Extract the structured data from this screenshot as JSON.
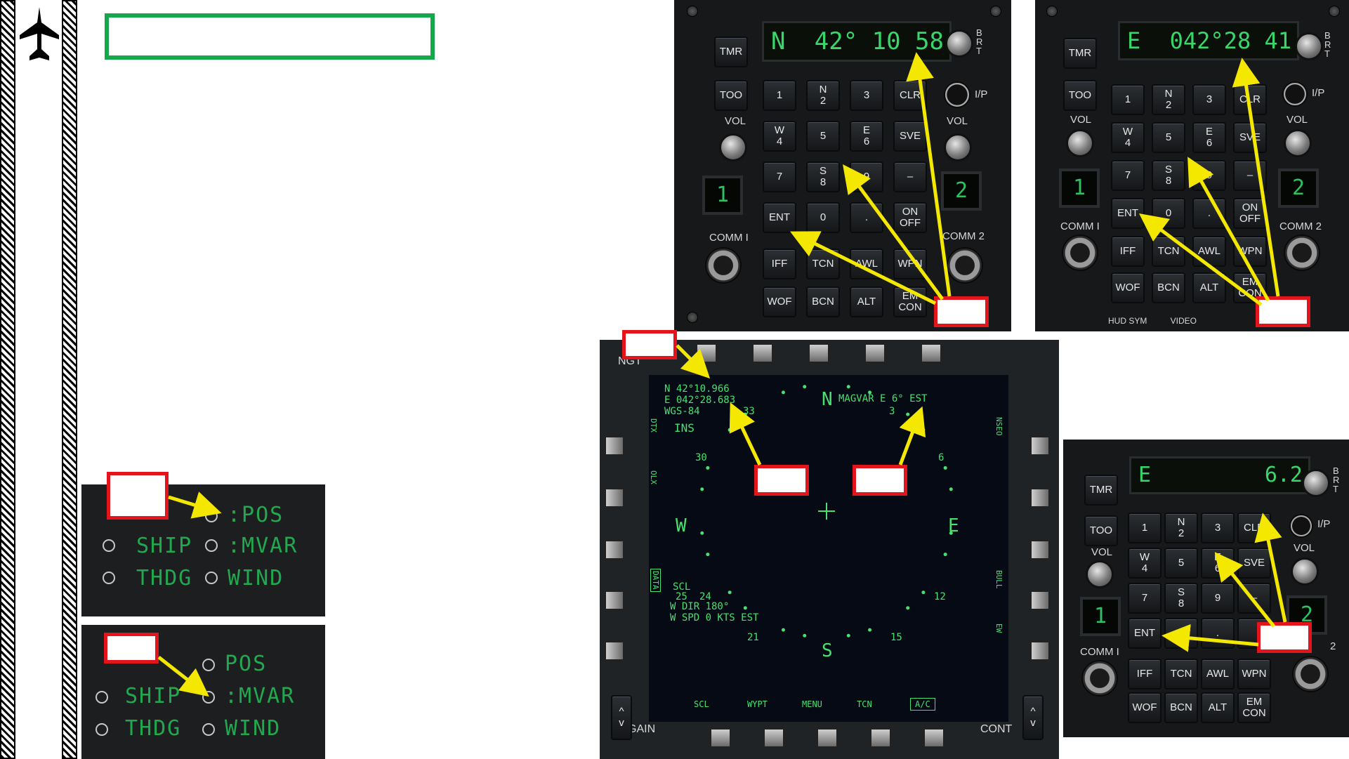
{
  "slide": {
    "icon": "aircraft-silhouette-icon",
    "title_box_color": "#14a84a",
    "callout_color": "#e3141b",
    "arrow_color": "#f4e800"
  },
  "ufc_top_left": {
    "display_left": "N",
    "display_right": "42° 10 58",
    "brt": "B\nR\nT",
    "keys": [
      {
        "top": "",
        "main": "1"
      },
      {
        "top": "N",
        "main": "2"
      },
      {
        "top": "",
        "main": "3"
      },
      {
        "top": "",
        "main": "CLR"
      },
      {
        "top": "W",
        "main": "4"
      },
      {
        "top": "",
        "main": "5"
      },
      {
        "top": "E",
        "main": "6"
      },
      {
        "top": "",
        "main": "SVE"
      },
      {
        "top": "",
        "main": "7"
      },
      {
        "top": "S",
        "main": "8"
      },
      {
        "top": "",
        "main": "9"
      },
      {
        "top": "",
        "main": "–"
      },
      {
        "top": "",
        "main": "ENT"
      },
      {
        "top": "",
        "main": "0"
      },
      {
        "top": "",
        "main": "."
      },
      {
        "top": "ON",
        "main": "OFF"
      }
    ],
    "bottom_keys": [
      "IFF",
      "TCN",
      "AWL",
      "WPN",
      "WOF",
      "BCN",
      "ALT",
      "EM CON"
    ],
    "left_labels": {
      "tmr": "TMR",
      "too": "TOO",
      "vol": "VOL",
      "comm1": "COMM I"
    },
    "right_labels": {
      "ip": "I/P",
      "vol": "VOL",
      "comm2": "COMM 2"
    },
    "comm1_digit": "1",
    "comm2_digit": "2"
  },
  "ufc_top_right": {
    "display_left": "E",
    "display_right": "042°28 41",
    "brt": "B\nR\nT",
    "keys": [
      {
        "top": "",
        "main": "1"
      },
      {
        "top": "N",
        "main": "2"
      },
      {
        "top": "",
        "main": "3"
      },
      {
        "top": "",
        "main": "CLR"
      },
      {
        "top": "W",
        "main": "4"
      },
      {
        "top": "",
        "main": "5"
      },
      {
        "top": "E",
        "main": "6"
      },
      {
        "top": "",
        "main": "SVE"
      },
      {
        "top": "",
        "main": "7"
      },
      {
        "top": "S",
        "main": "8"
      },
      {
        "top": "",
        "main": "9"
      },
      {
        "top": "",
        "main": "–"
      },
      {
        "top": "",
        "main": "ENT"
      },
      {
        "top": "",
        "main": "0"
      },
      {
        "top": "",
        "main": "."
      },
      {
        "top": "ON",
        "main": "OFF"
      }
    ],
    "bottom_keys": [
      "IFF",
      "TCN",
      "AWL",
      "WPN",
      "WOF",
      "BCN",
      "ALT",
      "EM CON"
    ],
    "left_labels": {
      "tmr": "TMR",
      "too": "TOO",
      "vol": "VOL",
      "comm1": "COMM I"
    },
    "right_labels": {
      "ip": "I/P",
      "vol": "VOL",
      "comm2": "COMM 2"
    },
    "comm1_digit": "1",
    "comm2_digit": "2",
    "footer": "HUD SYM          VIDEO"
  },
  "ufc_bottom_right": {
    "display_left": "E",
    "display_right": "6.2",
    "brt": "B\nR\nT",
    "keys": [
      {
        "top": "",
        "main": "1"
      },
      {
        "top": "N",
        "main": "2"
      },
      {
        "top": "",
        "main": "3"
      },
      {
        "top": "",
        "main": "CLR"
      },
      {
        "top": "W",
        "main": "4"
      },
      {
        "top": "",
        "main": "5"
      },
      {
        "top": "E",
        "main": "6"
      },
      {
        "top": "",
        "main": "SVE"
      },
      {
        "top": "",
        "main": "7"
      },
      {
        "top": "S",
        "main": "8"
      },
      {
        "top": "",
        "main": "9"
      },
      {
        "top": "",
        "main": "–"
      },
      {
        "top": "",
        "main": "ENT"
      },
      {
        "top": "",
        "main": "0"
      },
      {
        "top": "",
        "main": "."
      },
      {
        "top": "",
        "main": ""
      }
    ],
    "bottom_keys": [
      "IFF",
      "TCN",
      "AWL",
      "WPN",
      "WOF",
      "BCN",
      "ALT",
      "EM CON"
    ],
    "left_labels": {
      "tmr": "TMR",
      "too": "TOO",
      "vol": "VOL",
      "comm1": "COMM I"
    },
    "right_labels": {
      "ip": "I/P",
      "vol": "VOL",
      "comm2": "2"
    },
    "comm1_digit": "1",
    "comm2_digit": "2"
  },
  "mfd": {
    "ngt": "NGT",
    "pos_lat": "N  42°10.966",
    "pos_lon": "E 042°28.683",
    "datum": "WGS-84",
    "source": "INS",
    "magvar": "MAGVAR E 6° EST",
    "left_side": [
      "DTX",
      "OLX",
      "DATA"
    ],
    "right_side": [
      "NSEO",
      "BULL",
      "EW"
    ],
    "compass": {
      "n": "N",
      "e": "E",
      "s": "S",
      "w": "W",
      "t3": "3",
      "t6": "6",
      "t12": "12",
      "t15": "15",
      "t21": "21",
      "t24": "24",
      "t30": "30",
      "t33": "33"
    },
    "scl_label": "SCL",
    "scl_value": "25",
    "wind_dir": "W DIR 180°",
    "wind_spd": "W SPD 0 KTS EST",
    "bottom_options": [
      "SCL",
      "WYPT",
      "MENU",
      "TCN",
      "A/C"
    ],
    "gain": "GAIN",
    "cont": "CONT"
  },
  "option_panel_1": {
    "rows": [
      ":POS",
      "SHIP",
      ":MVAR",
      "THDG",
      "WIND"
    ]
  },
  "option_panel_2": {
    "rows": [
      "POS",
      "SHIP",
      ":MVAR",
      "THDG",
      "WIND"
    ]
  }
}
